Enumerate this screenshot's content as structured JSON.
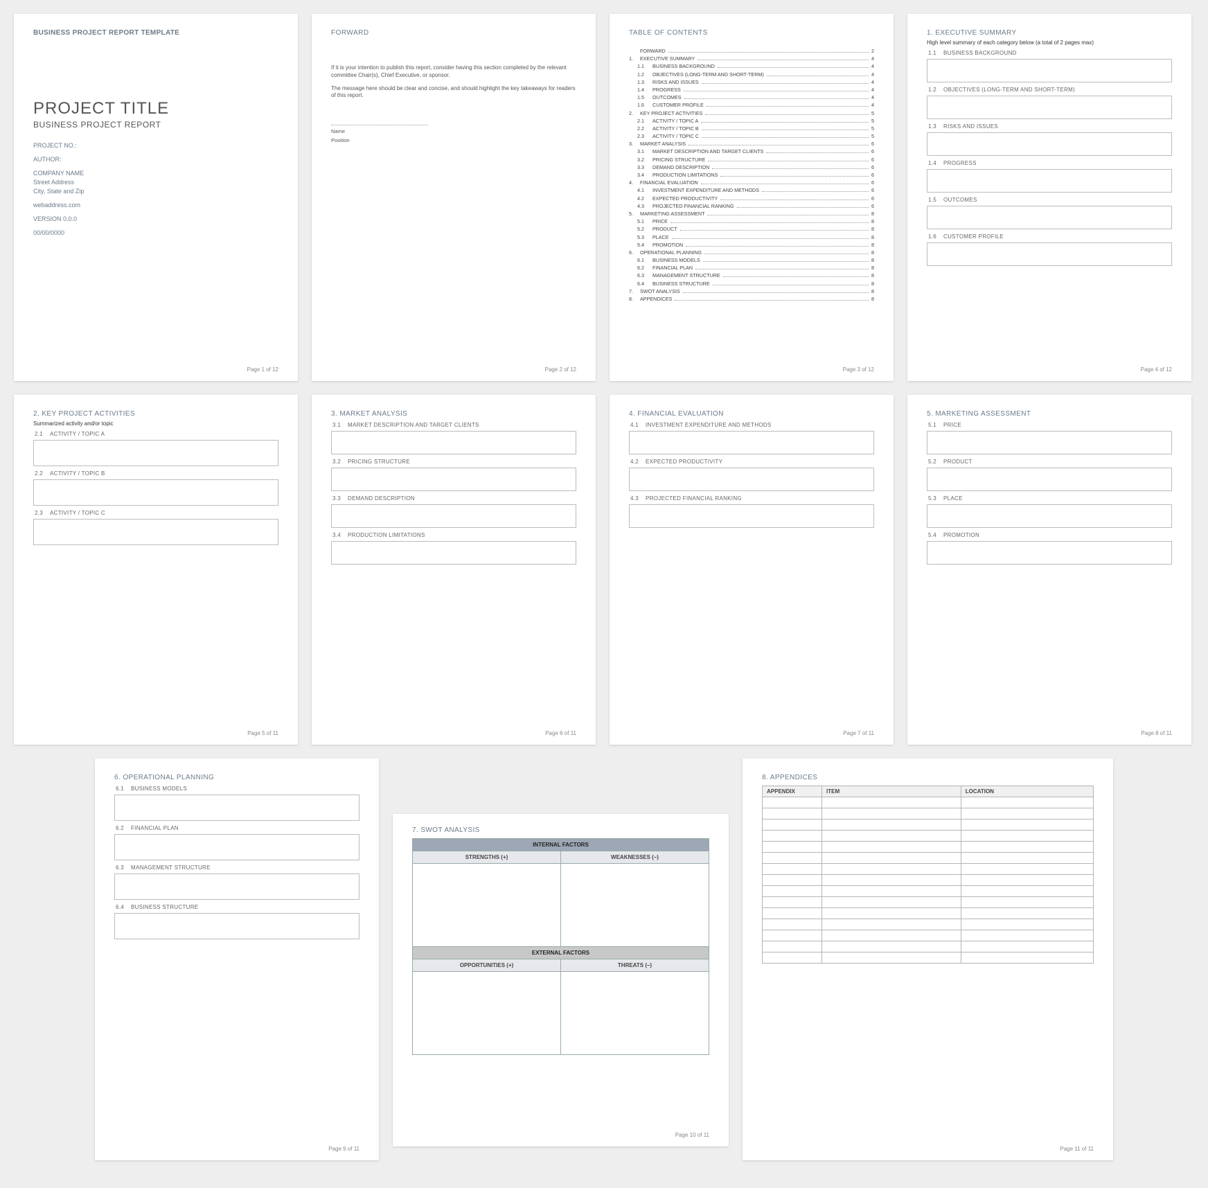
{
  "cover": {
    "header": "BUSINESS PROJECT REPORT TEMPLATE",
    "title": "PROJECT TITLE",
    "subtitle": "BUSINESS PROJECT REPORT",
    "project_no": "PROJECT NO.:",
    "author": "AUTHOR:",
    "company": "COMPANY NAME",
    "street": "Street Address",
    "city": "City, State and Zip",
    "web": "webaddress.com",
    "version": "VERSION 0.0.0",
    "date": "00/00/0000",
    "footer": "Page 1 of 12"
  },
  "forward": {
    "title": "FORWARD",
    "p1": "If it is your intention to publish this report, consider having this section completed by the relevant committee Chair(s), Chief Executive, or sponsor.",
    "p2": "The message here should be clear and concise, and should highlight the key takeaways for readers of this report.",
    "name": "Name",
    "position": "Position",
    "footer": "Page 2 of 12"
  },
  "toc": {
    "title": "TABLE OF CONTENTS",
    "items": [
      {
        "n": "",
        "t": "FORWARD",
        "p": "2",
        "sub": false
      },
      {
        "n": "1.",
        "t": "EXECUTIVE SUMMARY",
        "p": "4",
        "sub": false
      },
      {
        "n": "1.1",
        "t": "BUSINESS BACKGROUND",
        "p": "4",
        "sub": true
      },
      {
        "n": "1.2",
        "t": "OBJECTIVES (LONG-TERM AND SHORT-TERM)",
        "p": "4",
        "sub": true
      },
      {
        "n": "1.3",
        "t": "RISKS AND ISSUES",
        "p": "4",
        "sub": true
      },
      {
        "n": "1.4",
        "t": "PROGRESS",
        "p": "4",
        "sub": true
      },
      {
        "n": "1.5",
        "t": "OUTCOMES",
        "p": "4",
        "sub": true
      },
      {
        "n": "1.6",
        "t": "CUSTOMER PROFILE",
        "p": "4",
        "sub": true
      },
      {
        "n": "2.",
        "t": "KEY PROJECT ACTIVITIES",
        "p": "5",
        "sub": false
      },
      {
        "n": "2.1",
        "t": "ACTIVITY / TOPIC A",
        "p": "5",
        "sub": true
      },
      {
        "n": "2.2",
        "t": "ACTIVITY / TOPIC B",
        "p": "5",
        "sub": true
      },
      {
        "n": "2.3",
        "t": "ACTIVITY / TOPIC C",
        "p": "5",
        "sub": true
      },
      {
        "n": "3.",
        "t": "MARKET ANALYSIS",
        "p": "6",
        "sub": false
      },
      {
        "n": "3.1",
        "t": "MARKET DESCRIPTION AND TARGET CLIENTS",
        "p": "6",
        "sub": true
      },
      {
        "n": "3.2",
        "t": "PRICING STRUCTURE",
        "p": "6",
        "sub": true
      },
      {
        "n": "3.3",
        "t": "DEMAND DESCRIPTION",
        "p": "6",
        "sub": true
      },
      {
        "n": "3.4",
        "t": "PRODUCTION LIMITATIONS",
        "p": "6",
        "sub": true
      },
      {
        "n": "4.",
        "t": "FINANCIAL EVALUATION",
        "p": "6",
        "sub": false
      },
      {
        "n": "4.1",
        "t": "INVESTMENT EXPENDITURE AND METHODS",
        "p": "6",
        "sub": true
      },
      {
        "n": "4.2",
        "t": "EXPECTED PRODUCTIVITY",
        "p": "6",
        "sub": true
      },
      {
        "n": "4.3",
        "t": "PROJECTED FINANCIAL RANKING",
        "p": "6",
        "sub": true
      },
      {
        "n": "5.",
        "t": "MARKETING ASSESSMENT",
        "p": "8",
        "sub": false
      },
      {
        "n": "5.1",
        "t": "PRICE",
        "p": "8",
        "sub": true
      },
      {
        "n": "5.2",
        "t": "PRODUCT",
        "p": "8",
        "sub": true
      },
      {
        "n": "5.3",
        "t": "PLACE",
        "p": "8",
        "sub": true
      },
      {
        "n": "5.4",
        "t": "PROMOTION",
        "p": "8",
        "sub": true
      },
      {
        "n": "6.",
        "t": "OPERATIONAL PLANNING",
        "p": "8",
        "sub": false
      },
      {
        "n": "6.1",
        "t": "BUSINESS MODELS",
        "p": "8",
        "sub": true
      },
      {
        "n": "6.2",
        "t": "FINANCIAL PLAN",
        "p": "8",
        "sub": true
      },
      {
        "n": "6.3",
        "t": "MANAGEMENT STRUCTURE",
        "p": "8",
        "sub": true
      },
      {
        "n": "6.4",
        "t": "BUSINESS STRUCTURE",
        "p": "8",
        "sub": true
      },
      {
        "n": "7.",
        "t": "SWOT ANALYSIS",
        "p": "8",
        "sub": false
      },
      {
        "n": "8.",
        "t": "APPENDICES",
        "p": "8",
        "sub": false
      }
    ],
    "footer": "Page 3 of 12"
  },
  "p4": {
    "title": "1.  EXECUTIVE SUMMARY",
    "note": "High level summary of each category below (a total of 2 pages max)",
    "subs": [
      {
        "n": "1.1",
        "t": "BUSINESS BACKGROUND"
      },
      {
        "n": "1.2",
        "t": "OBJECTIVES (LONG-TERM AND SHORT-TERM)"
      },
      {
        "n": "1.3",
        "t": "RISKS AND ISSUES"
      },
      {
        "n": "1.4",
        "t": "PROGRESS"
      },
      {
        "n": "1.5",
        "t": "OUTCOMES"
      },
      {
        "n": "1.6",
        "t": "CUSTOMER PROFILE"
      }
    ],
    "footer": "Page 4 of 12"
  },
  "p5": {
    "title": "2.  KEY PROJECT ACTIVITIES",
    "note": "Summarized activity and/or topic",
    "subs": [
      {
        "n": "2.1",
        "t": "ACTIVITY / TOPIC A"
      },
      {
        "n": "2.2",
        "t": "ACTIVITY / TOPIC B"
      },
      {
        "n": "2.3",
        "t": "ACTIVITY / TOPIC C"
      }
    ],
    "footer": "Page 5 of 11"
  },
  "p6": {
    "title": "3.  MARKET ANALYSIS",
    "subs": [
      {
        "n": "3.1",
        "t": "MARKET DESCRIPTION AND TARGET CLIENTS"
      },
      {
        "n": "3.2",
        "t": "PRICING STRUCTURE"
      },
      {
        "n": "3.3",
        "t": "DEMAND DESCRIPTION"
      },
      {
        "n": "3.4",
        "t": "PRODUCTION LIMITATIONS"
      }
    ],
    "footer": "Page 6 of 11"
  },
  "p7": {
    "title": "4.  FINANCIAL EVALUATION",
    "subs": [
      {
        "n": "4.1",
        "t": "INVESTMENT EXPENDITURE AND METHODS"
      },
      {
        "n": "4.2",
        "t": "EXPECTED PRODUCTIVITY"
      },
      {
        "n": "4.3",
        "t": "PROJECTED FINANCIAL RANKING"
      }
    ],
    "footer": "Page 7 of 11"
  },
  "p8": {
    "title": "5.  MARKETING ASSESSMENT",
    "subs": [
      {
        "n": "5.1",
        "t": "PRICE"
      },
      {
        "n": "5.2",
        "t": "PRODUCT"
      },
      {
        "n": "5.3",
        "t": "PLACE"
      },
      {
        "n": "5.4",
        "t": "PROMOTION"
      }
    ],
    "footer": "Page 8 of 11"
  },
  "p9": {
    "title": "6.  OPERATIONAL PLANNING",
    "subs": [
      {
        "n": "6.1",
        "t": "BUSINESS MODELS"
      },
      {
        "n": "6.2",
        "t": "FINANCIAL PLAN"
      },
      {
        "n": "6.3",
        "t": "MANAGEMENT STRUCTURE"
      },
      {
        "n": "6.4",
        "t": "BUSINESS STRUCTURE"
      }
    ],
    "footer": "Page 9 of 11"
  },
  "p10": {
    "title": "7.  SWOT ANALYSIS",
    "internal": "INTERNAL FACTORS",
    "external": "EXTERNAL FACTORS",
    "strengths": "STRENGTHS (+)",
    "weaknesses": "WEAKNESSES (–)",
    "opportunities": "OPPORTUNITIES (+)",
    "threats": "THREATS (–)",
    "footer": "Page 10 of 11"
  },
  "p11": {
    "title": "8.  APPENDICES",
    "cols": [
      "APPENDIX",
      "ITEM",
      "LOCATION"
    ],
    "rows": 15,
    "footer": "Page 11 of 11"
  }
}
